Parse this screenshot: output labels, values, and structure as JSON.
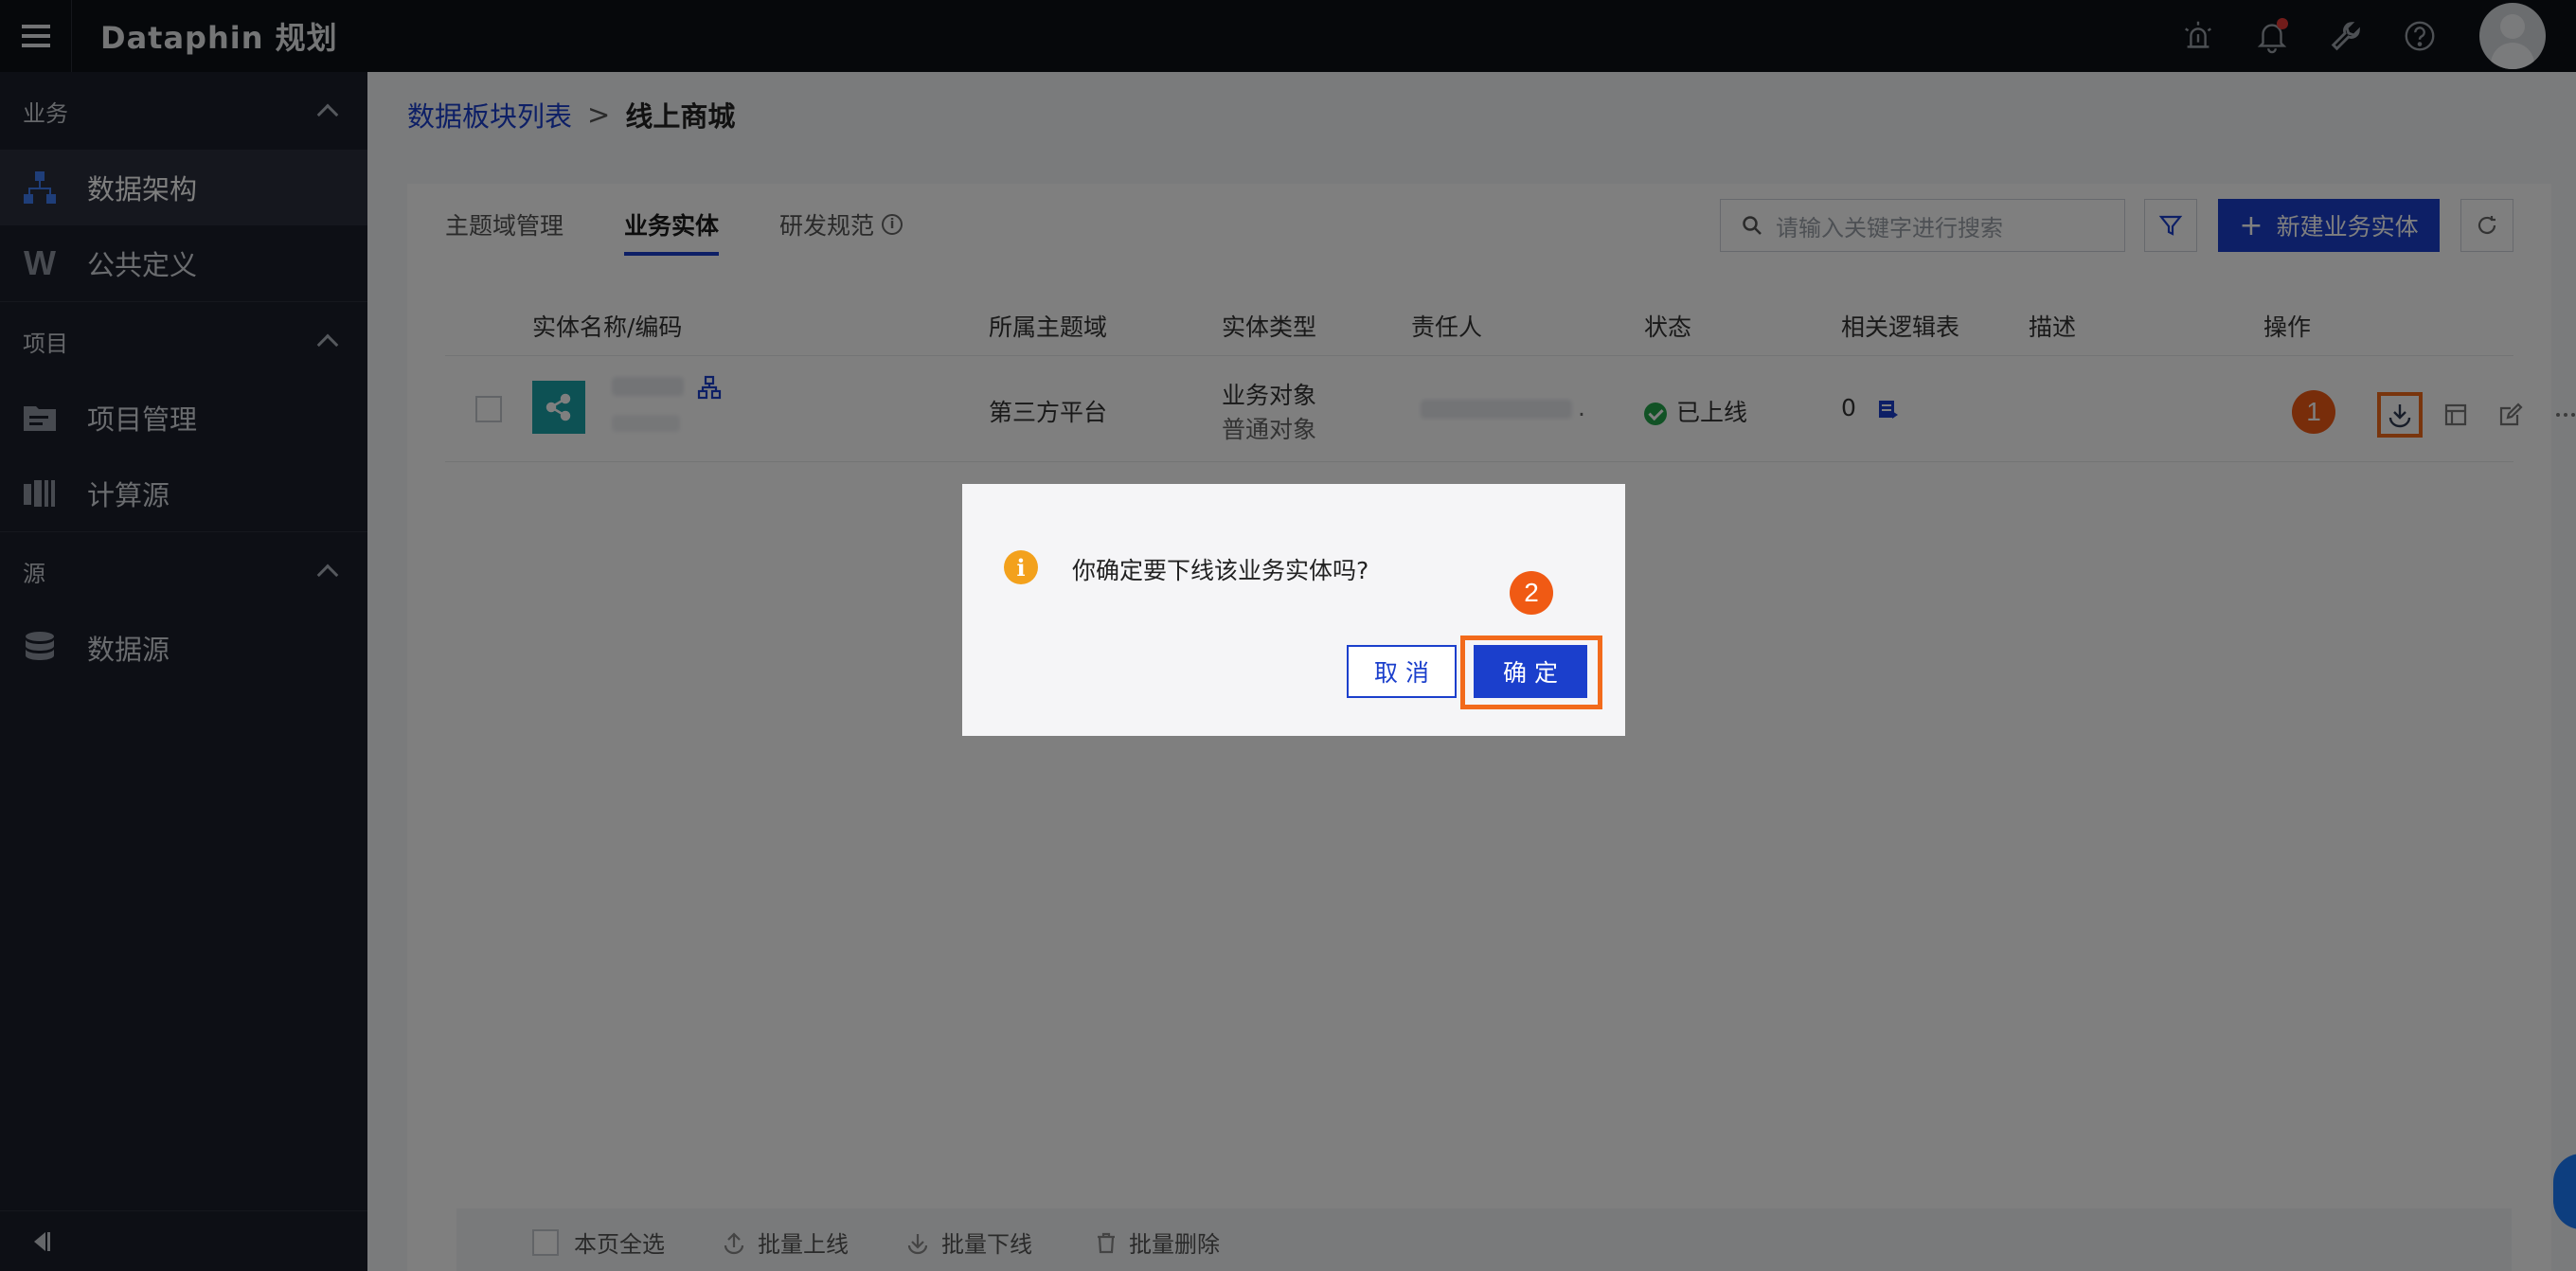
{
  "app": {
    "brand": "Dataphin 规划"
  },
  "sidebar": {
    "groups": [
      {
        "label": "业务",
        "items": [
          {
            "label": "数据架构",
            "icon": "architecture-icon"
          },
          {
            "label": "公共定义",
            "icon": "w-icon"
          }
        ]
      },
      {
        "label": "项目",
        "items": [
          {
            "label": "项目管理",
            "icon": "folder-icon"
          },
          {
            "label": "计算源",
            "icon": "compute-icon"
          }
        ]
      },
      {
        "label": "源",
        "items": [
          {
            "label": "数据源",
            "icon": "database-icon"
          }
        ]
      }
    ]
  },
  "breadcrumb": {
    "parent": "数据板块列表",
    "separator": ">",
    "current": "线上商城"
  },
  "tabs": [
    {
      "label": "主题域管理"
    },
    {
      "label": "业务实体"
    },
    {
      "label": "研发规范"
    }
  ],
  "toolbar": {
    "search_placeholder": "请输入关键字进行搜索",
    "new_button": "新建业务实体",
    "new_button_icon": "+"
  },
  "table": {
    "headers": [
      "实体名称/编码",
      "所属主题域",
      "实体类型",
      "责任人",
      "状态",
      "相关逻辑表",
      "描述",
      "操作"
    ],
    "rows": [
      {
        "domain": "第三方平台",
        "type_main": "业务对象",
        "type_sub": "普通对象",
        "owner_suffix": ".",
        "status": "已上线",
        "logic_tables": "0"
      }
    ]
  },
  "annotations": {
    "step1": "1",
    "step2": "2"
  },
  "bottom_bar": {
    "select_all": "本页全选",
    "batch_online": "批量上线",
    "batch_offline": "批量下线",
    "batch_delete": "批量删除"
  },
  "dialog": {
    "message": "你确定要下线该业务实体吗?",
    "cancel": "取 消",
    "ok": "确 定"
  },
  "colors": {
    "primary": "#1b3fcc",
    "highlight": "#f26a1b",
    "success": "#22a54a",
    "warning": "#f3a11c",
    "teal": "#1aa3a9"
  }
}
